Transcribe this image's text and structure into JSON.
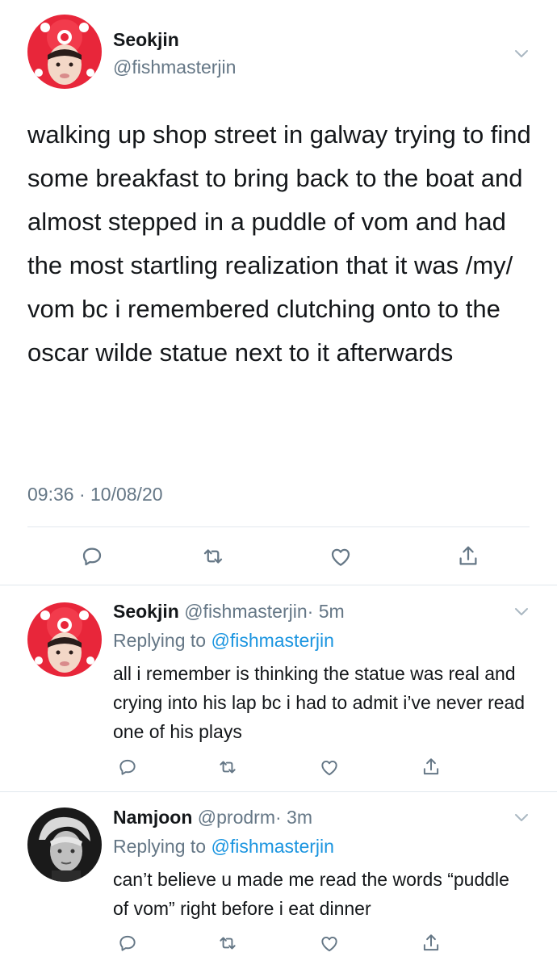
{
  "main_tweet": {
    "display_name": "Seokjin",
    "handle": "@fishmasterjin",
    "body": "walking up shop street in galway trying to find some breakfast to bring back to the boat and almost stepped in a puddle of vom and had the most startling realization that it was /my/ vom bc i remembered clutching onto to the oscar wilde statue next to it afterwards",
    "timestamp": "09:36 · 10/08/20"
  },
  "replies": [
    {
      "display_name": "Seokjin",
      "handle": "@fishmasterjin",
      "age": "· 5m",
      "replying_label": "Replying to",
      "replying_to": "@fishmasterjin",
      "body": "all i remember is thinking the statue was real and crying into his lap bc i had to admit i’ve never read one of his plays"
    },
    {
      "display_name": "Namjoon",
      "handle": "@prodrm",
      "age": "· 3m",
      "replying_label": "Replying to",
      "replying_to": "@fishmasterjin",
      "body": "can’t believe u made me read the words “puddle of vom” right before i eat dinner"
    }
  ],
  "icons": {
    "reply": "reply-icon",
    "retweet": "retweet-icon",
    "like": "heart-icon",
    "share": "share-icon",
    "menu": "chevron-down-icon"
  },
  "colors": {
    "text": "#14171a",
    "muted": "#657786",
    "link": "#1b95e0",
    "divider": "#e1e8ed"
  }
}
